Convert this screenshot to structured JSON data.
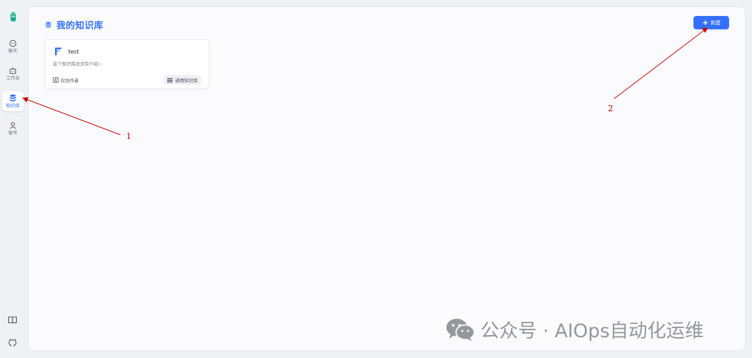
{
  "sidebar": {
    "items": [
      {
        "label": "聊天",
        "icon": "chat-icon"
      },
      {
        "label": "工作台",
        "icon": "robot-icon"
      },
      {
        "label": "知识库",
        "icon": "database-icon",
        "active": true
      },
      {
        "label": "账号",
        "icon": "user-icon"
      }
    ],
    "bottom_icons": [
      "book-icon",
      "github-icon"
    ]
  },
  "header": {
    "title": "我的知识库",
    "new_button_label": "新建"
  },
  "knowledge_bases": [
    {
      "name": "test",
      "description": "这个知识库还没有介绍~",
      "permission": "仅协作者",
      "type": "通用知识库"
    }
  ],
  "annotations": [
    {
      "label": "1"
    },
    {
      "label": "2"
    }
  ],
  "watermark": {
    "text": "公众号 · AIOps自动化运维"
  },
  "colors": {
    "accent": "#3370ff",
    "annotation": "#d10000"
  }
}
